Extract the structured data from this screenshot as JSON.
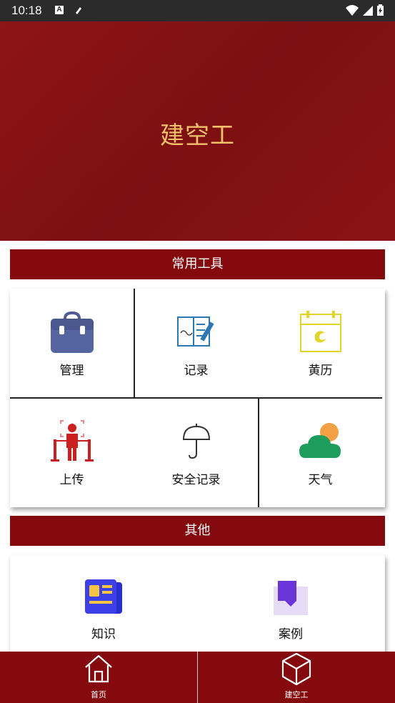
{
  "status": {
    "time": "10:18",
    "icon_a": "A"
  },
  "hero": {
    "title": "建空工"
  },
  "sections": {
    "tools": "常用工具",
    "other": "其他"
  },
  "tools": [
    {
      "label": "管理",
      "icon": "toolbox-icon"
    },
    {
      "label": "记录",
      "icon": "notebook-icon"
    },
    {
      "label": "黄历",
      "icon": "calendar-icon"
    },
    {
      "label": "上传",
      "icon": "upload-person-icon"
    },
    {
      "label": "安全记录",
      "icon": "umbrella-icon"
    },
    {
      "label": "天气",
      "icon": "weather-icon"
    }
  ],
  "other": [
    {
      "label": "知识",
      "icon": "news-icon"
    },
    {
      "label": "案例",
      "icon": "folder-icon"
    }
  ],
  "nav": [
    {
      "label": "首页",
      "icon": "home-icon"
    },
    {
      "label": "建空工",
      "icon": "cube-icon"
    }
  ],
  "colors": {
    "primary": "#850a0d",
    "hero_title": "#f3c06a"
  }
}
